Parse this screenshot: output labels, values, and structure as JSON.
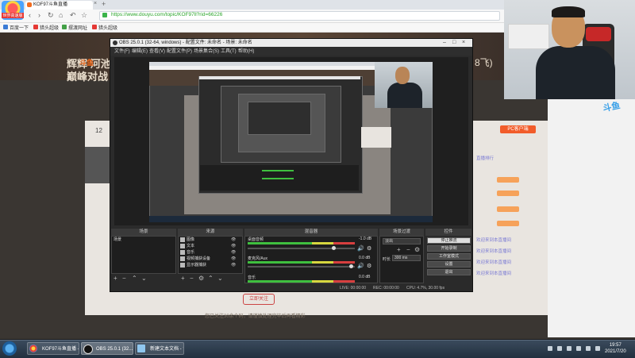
{
  "browser": {
    "logo_text": "世界高速版",
    "tab_title": "KOF97斗鱼直播",
    "url": "https://www.douyu.com/topic/KOF97ll?rid=66226",
    "bookmarks": [
      "百度一下",
      "猎头超级",
      "摆渡网址",
      "猎头超级"
    ]
  },
  "page": {
    "logo": "斗鱼",
    "title_line1": "辉辉 河池",
    "title_line2": "巅峰对战",
    "title_suffix": "8飞)",
    "panel_number": "12",
    "pc_badge": "PC客户端",
    "footer_text": "您已关注30余个码，请谨慎处理完毕后再看精彩",
    "red_button": "立即关注",
    "right_list": [
      "直播排行",
      "欢迎来到本直播间",
      "欢迎来到本直播间",
      "欢迎来到本直播间",
      "欢迎来到本直播间"
    ]
  },
  "webcam_logo": "斗鱼",
  "obs": {
    "title": "OBS 25.0.1 (32-64, windows) - 配置文件: 未命名 - 场景: 未命名",
    "menu": [
      "文件(F)",
      "编辑(E)",
      "查看(V)",
      "配置文件(P)",
      "场景集合(S)",
      "工具(T)",
      "帮助(H)"
    ],
    "docks": {
      "scenes": {
        "header": "场景",
        "items": [
          "场景"
        ]
      },
      "sources": {
        "header": "来源",
        "items": [
          "图像",
          "文本",
          "音乐",
          "视频捕获设备",
          "显示器捕获"
        ]
      },
      "mixer": {
        "header": "混音器",
        "channels": [
          {
            "name": "桌面音频",
            "level": "-1.0 dB"
          },
          {
            "name": "麦克风/Aux",
            "level": "0.0 dB"
          },
          {
            "name": "音乐",
            "level": "0.0 dB"
          }
        ]
      },
      "transitions": {
        "header": "场景过渡",
        "type": "淡出",
        "duration_label": "时长",
        "duration": "300 ms"
      },
      "controls": {
        "header": "控件",
        "buttons": [
          "停止推流",
          "开始录制",
          "工作室模式",
          "设置",
          "退出"
        ]
      }
    },
    "status": {
      "live": "LIVE: 00:00:00",
      "rec": "REC: 00:00:00",
      "cpu": "CPU: 4.7%, 30.00 fps"
    }
  },
  "taskbar": {
    "tasks": [
      "KOF97斗鱼直播 - 3...",
      "OBS 25.0.1 (32...",
      "新建文本文档 - 记..."
    ],
    "time": "19:57",
    "date": "2021/7/20"
  }
}
